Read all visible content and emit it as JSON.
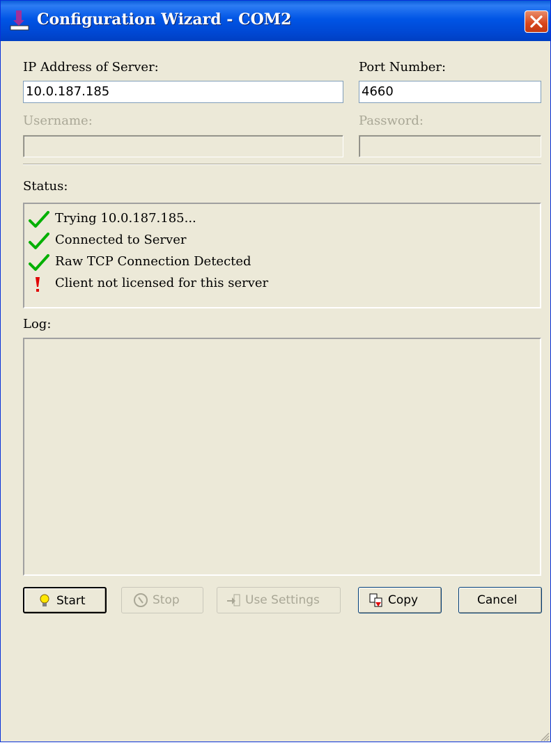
{
  "window": {
    "title": "Configuration Wizard - COM2",
    "title_icon": "wizard-icon",
    "close_icon": "close-icon"
  },
  "fields": {
    "ip_label": "IP Address of Server:",
    "ip_value": "10.0.187.185",
    "port_label": "Port Number:",
    "port_value": "4660",
    "username_label": "Username:",
    "username_value": "",
    "password_label": "Password:",
    "password_value": ""
  },
  "status": {
    "label": "Status:",
    "items": [
      {
        "icon": "check-icon",
        "text": "Trying 10.0.187.185..."
      },
      {
        "icon": "check-icon",
        "text": "Connected to Server"
      },
      {
        "icon": "check-icon",
        "text": "Raw TCP Connection Detected"
      },
      {
        "icon": "exclamation-icon",
        "text": "Client not licensed for this server"
      }
    ]
  },
  "log": {
    "label": "Log:",
    "content": ""
  },
  "buttons": {
    "start": "Start",
    "stop": "Stop",
    "use_settings": "Use Settings",
    "copy": "Copy",
    "cancel": "Cancel"
  },
  "colors": {
    "titlebar": "#0055e5",
    "window_bg": "#ece9d8",
    "check": "#00b000",
    "exclamation": "#e00000",
    "disabled_text": "#a9a796"
  }
}
